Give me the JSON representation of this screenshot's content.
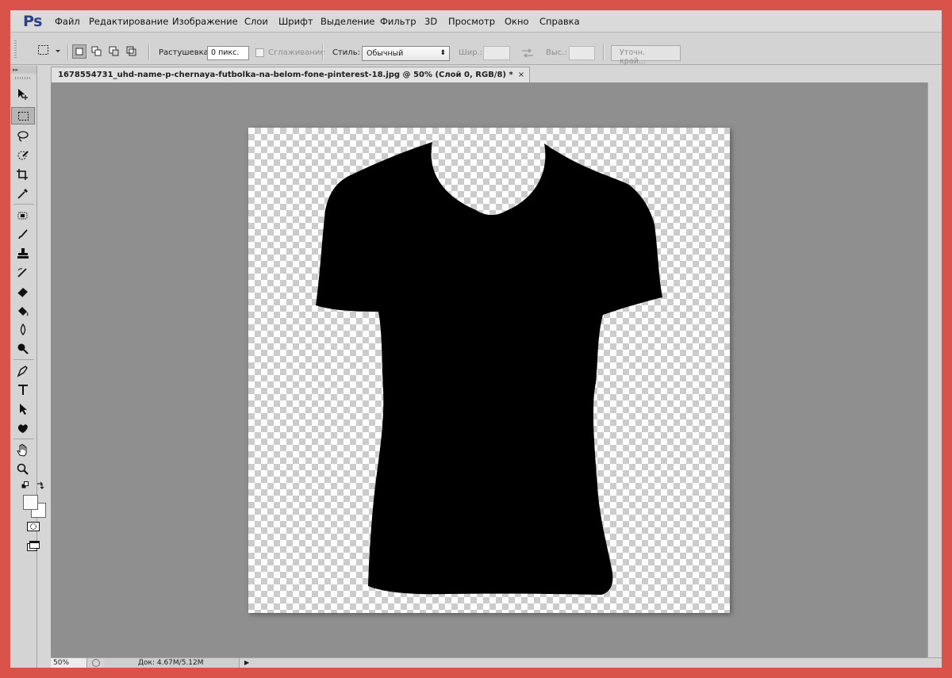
{
  "app": {
    "logo": "Ps"
  },
  "menu": [
    "Файл",
    "Редактирование",
    "Изображение",
    "Слои",
    "Шрифт",
    "Выделение",
    "Фильтр",
    "3D",
    "Просмотр",
    "Окно",
    "Справка"
  ],
  "options": {
    "feather_label": "Растушевка:",
    "feather_value": "0 пикс.",
    "antialias_label": "Сглаживание",
    "style_label": "Стиль:",
    "style_value": "Обычный",
    "width_label": "Шир.:",
    "height_label": "Выс.:",
    "refine_edge_label": "Уточн. край..."
  },
  "document": {
    "tab_title": "1678554731_uhd-name-p-chernaya-futbolka-na-belom-fone-pinterest-18.jpg @ 50% (Слой 0, RGB/8) *",
    "close_glyph": "×",
    "content": "black-tshirt-silhouette-on-transparent-background"
  },
  "status": {
    "zoom": "50%",
    "doc_info": "Док: 4.67M/5.12M",
    "arrow": "▶"
  },
  "colors": {
    "frame": "#d9534a",
    "workspace": "#8f8f8f",
    "ui": "#d6d6d6",
    "logo": "#2d3f86",
    "shirt": "#000000"
  },
  "icons": {
    "tools": [
      "move-icon",
      "rect-marquee-icon",
      "lasso-icon",
      "quick-select-icon",
      "crop-icon",
      "eyedropper-icon",
      "healing-brush-icon",
      "brush-icon",
      "clone-stamp-icon",
      "history-brush-icon",
      "eraser-icon",
      "paint-bucket-icon",
      "blur-icon",
      "dodge-icon",
      "pen-icon",
      "type-icon",
      "path-select-icon",
      "shape-icon",
      "hand-icon",
      "zoom-icon"
    ]
  }
}
